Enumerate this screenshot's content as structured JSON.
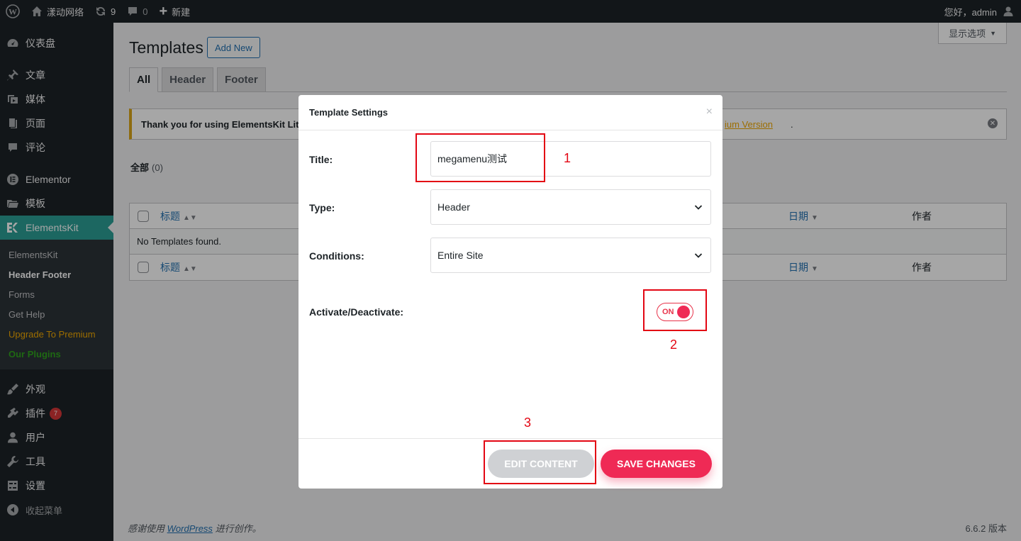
{
  "admin_bar": {
    "site_name": "漾动网络",
    "updates_count": "9",
    "comments_count": "0",
    "new_label": "新建",
    "greeting": "您好，admin"
  },
  "sidebar": {
    "items": [
      {
        "label": "仪表盘",
        "icon": "dashboard-icon"
      },
      {
        "label": "文章",
        "icon": "pin-icon"
      },
      {
        "label": "媒体",
        "icon": "media-icon"
      },
      {
        "label": "页面",
        "icon": "page-icon"
      },
      {
        "label": "评论",
        "icon": "comment-icon"
      },
      {
        "label": "Elementor",
        "icon": "elementor-icon"
      },
      {
        "label": "模板",
        "icon": "folder-icon"
      },
      {
        "label": "ElementsKit",
        "icon": "elementskit-icon"
      }
    ],
    "submenu": [
      "ElementsKit",
      "Header Footer",
      "Forms",
      "Get Help",
      "Upgrade To Premium",
      "Our Plugins"
    ],
    "items_lower": [
      {
        "label": "外观",
        "icon": "brush-icon"
      },
      {
        "label": "插件",
        "icon": "plugin-icon",
        "badge": "7"
      },
      {
        "label": "用户",
        "icon": "user-icon"
      },
      {
        "label": "工具",
        "icon": "wrench-icon"
      },
      {
        "label": "设置",
        "icon": "settings-icon"
      },
      {
        "label": "收起菜单",
        "icon": "collapse-icon"
      }
    ]
  },
  "main": {
    "screen_options": "显示选项",
    "title": "Templates",
    "add_new": "Add New",
    "tabs": [
      "All",
      "Header",
      "Footer"
    ],
    "notice_text": "Thank you for using ElementsKit Lit",
    "notice_link": "ium Version",
    "notice_end": ".",
    "filter_all": "全部",
    "filter_count": "(0)",
    "table": {
      "col_title": "标题",
      "col_date": "日期",
      "col_author": "作者",
      "empty": "No Templates found."
    },
    "footer_prefix": "感谢使用",
    "footer_link": "WordPress",
    "footer_suffix": "进行创作。",
    "version": "6.6.2 版本"
  },
  "modal": {
    "heading": "Template Settings",
    "close": "×",
    "title_label": "Title:",
    "title_value": "megamenu测试",
    "type_label": "Type:",
    "type_value": "Header",
    "conditions_label": "Conditions:",
    "conditions_value": "Entire Site",
    "activate_label": "Activate/Deactivate:",
    "toggle_label": "ON",
    "toggle_state": "on",
    "edit_button": "EDIT CONTENT",
    "save_button": "SAVE CHANGES"
  },
  "annotations": [
    "1",
    "2",
    "3"
  ],
  "colors": {
    "accent": "#ef2a55",
    "wp_blue": "#2271b1",
    "menu_current": "#2c9f96",
    "annotation_red": "#e30613"
  }
}
